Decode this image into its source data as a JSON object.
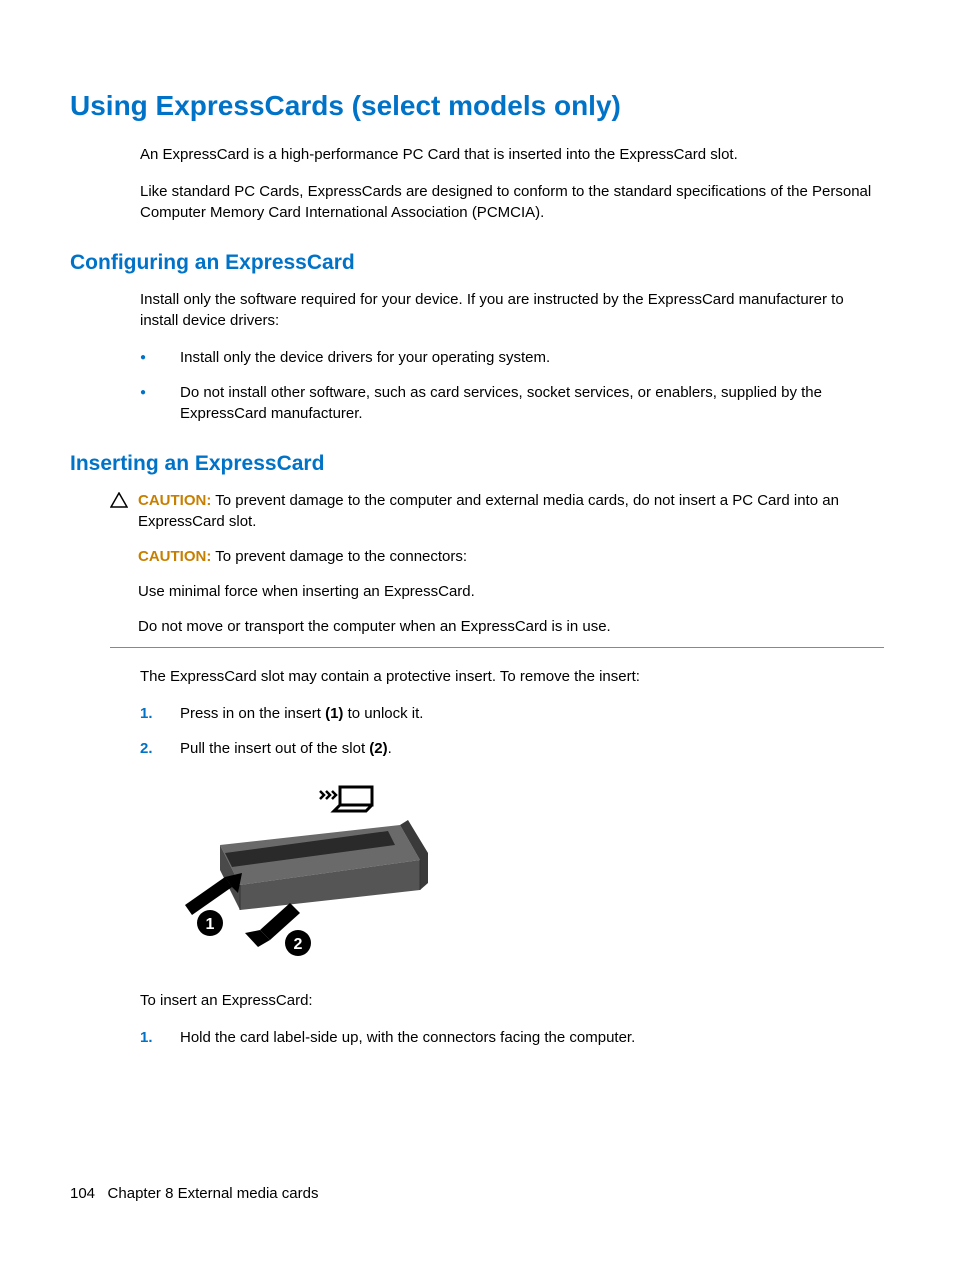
{
  "title": "Using ExpressCards (select models only)",
  "intro": {
    "p1": "An ExpressCard is a high-performance PC Card that is inserted into the ExpressCard slot.",
    "p2": "Like standard PC Cards, ExpressCards are designed to conform to the standard specifications of the Personal Computer Memory Card International Association (PCMCIA)."
  },
  "section1": {
    "heading": "Configuring an ExpressCard",
    "intro": "Install only the software required for your device. If you are instructed by the ExpressCard manufacturer to install device drivers:",
    "bullets": [
      "Install only the device drivers for your operating system.",
      "Do not install other software, such as card services, socket services, or enablers, supplied by the ExpressCard manufacturer."
    ]
  },
  "section2": {
    "heading": "Inserting an ExpressCard",
    "caution_label": "CAUTION:",
    "caution1": "To prevent damage to the computer and external media cards, do not insert a PC Card into an ExpressCard slot.",
    "caution2": "To prevent damage to the connectors:",
    "caution2_line1": "Use minimal force when inserting an ExpressCard.",
    "caution2_line2": "Do not move or transport the computer when an ExpressCard is in use.",
    "after_caution": "The ExpressCard slot may contain a protective insert. To remove the insert:",
    "steps": {
      "s1_pre": "Press in on the insert ",
      "s1_bold": "(1)",
      "s1_post": " to unlock it.",
      "s2_pre": "Pull the insert out of the slot ",
      "s2_bold": "(2)",
      "s2_post": "."
    },
    "after_image": "To insert an ExpressCard:",
    "steps2": {
      "s1": "Hold the card label-side up, with the connectors facing the computer."
    }
  },
  "footer": {
    "page": "104",
    "chapter": "Chapter 8   External media cards"
  }
}
